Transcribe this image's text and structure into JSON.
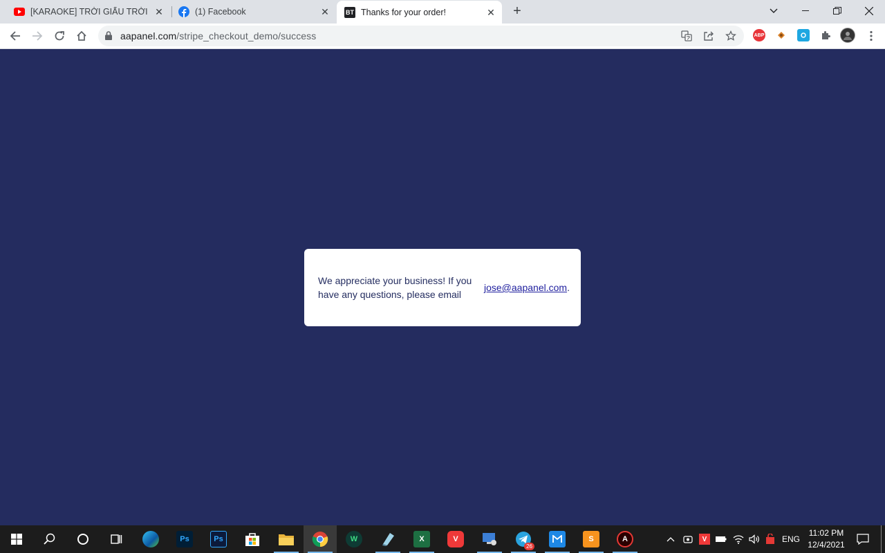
{
  "browser": {
    "tabs": [
      {
        "title": "[KARAOKE] TRỜI GIẤU TRỜI MANG ĐI",
        "favicon": "youtube-icon"
      },
      {
        "title": "(1) Facebook",
        "favicon": "facebook-icon"
      },
      {
        "title": "Thanks for your order!",
        "favicon": "bt-icon",
        "favicon_text": "BT",
        "active": true
      }
    ],
    "address": {
      "domain": "aapanel.com",
      "path": "/stripe_checkout_demo/success"
    },
    "extensions": [
      "abp-icon",
      "fox-extension-icon",
      "camera-extension-icon",
      "puzzle-icon",
      "profile-avatar"
    ],
    "abp_label": "ABP"
  },
  "page": {
    "background": "#242c5f",
    "message": "We appreciate your business! If you have any questions, please email",
    "email": "jose@aapanel.com",
    "email_suffix": "."
  },
  "taskbar": {
    "apps": [
      "edge",
      "photoshop",
      "photoshop-cc",
      "store",
      "file-explorer",
      "chrome",
      "wakatime",
      "paint",
      "excel",
      "vivaldi",
      "remote-desktop",
      "telegram",
      "mail",
      "sublime",
      "app-a"
    ],
    "telegram_badge": "26",
    "language": "ENG",
    "time": "11:02 PM",
    "date": "12/4/2021"
  }
}
